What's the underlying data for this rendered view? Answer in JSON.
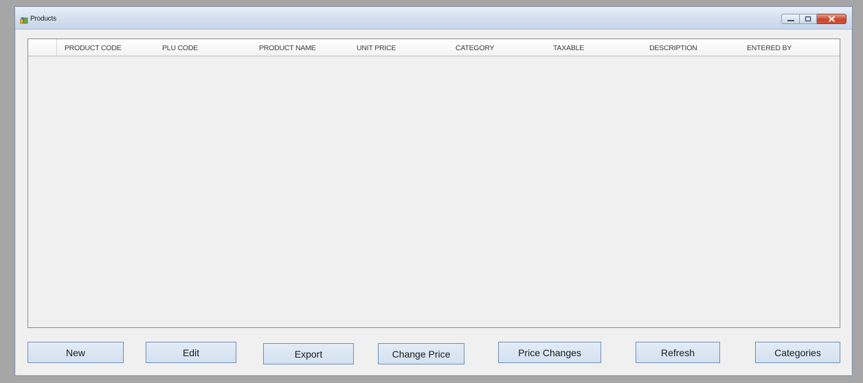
{
  "window": {
    "title": "Products",
    "title_icon": "app-icon",
    "caption_icons": [
      "minimize-icon",
      "maximize-icon",
      "close-icon"
    ]
  },
  "grid": {
    "columns": [
      "PRODUCT CODE",
      "PLU CODE",
      "PRODUCT NAME",
      "UNIT PRICE",
      "CATEGORY",
      "TAXABLE",
      "DESCRIPTION",
      "ENTERED BY"
    ],
    "rows": []
  },
  "buttons": {
    "new": "New",
    "edit": "Edit",
    "export": "Export",
    "change_price": "Change Price",
    "price_changes": "Price Changes",
    "refresh": "Refresh",
    "categories": "Categories"
  },
  "colors": {
    "accent": "#d3e1f0",
    "close": "#c7452d"
  }
}
